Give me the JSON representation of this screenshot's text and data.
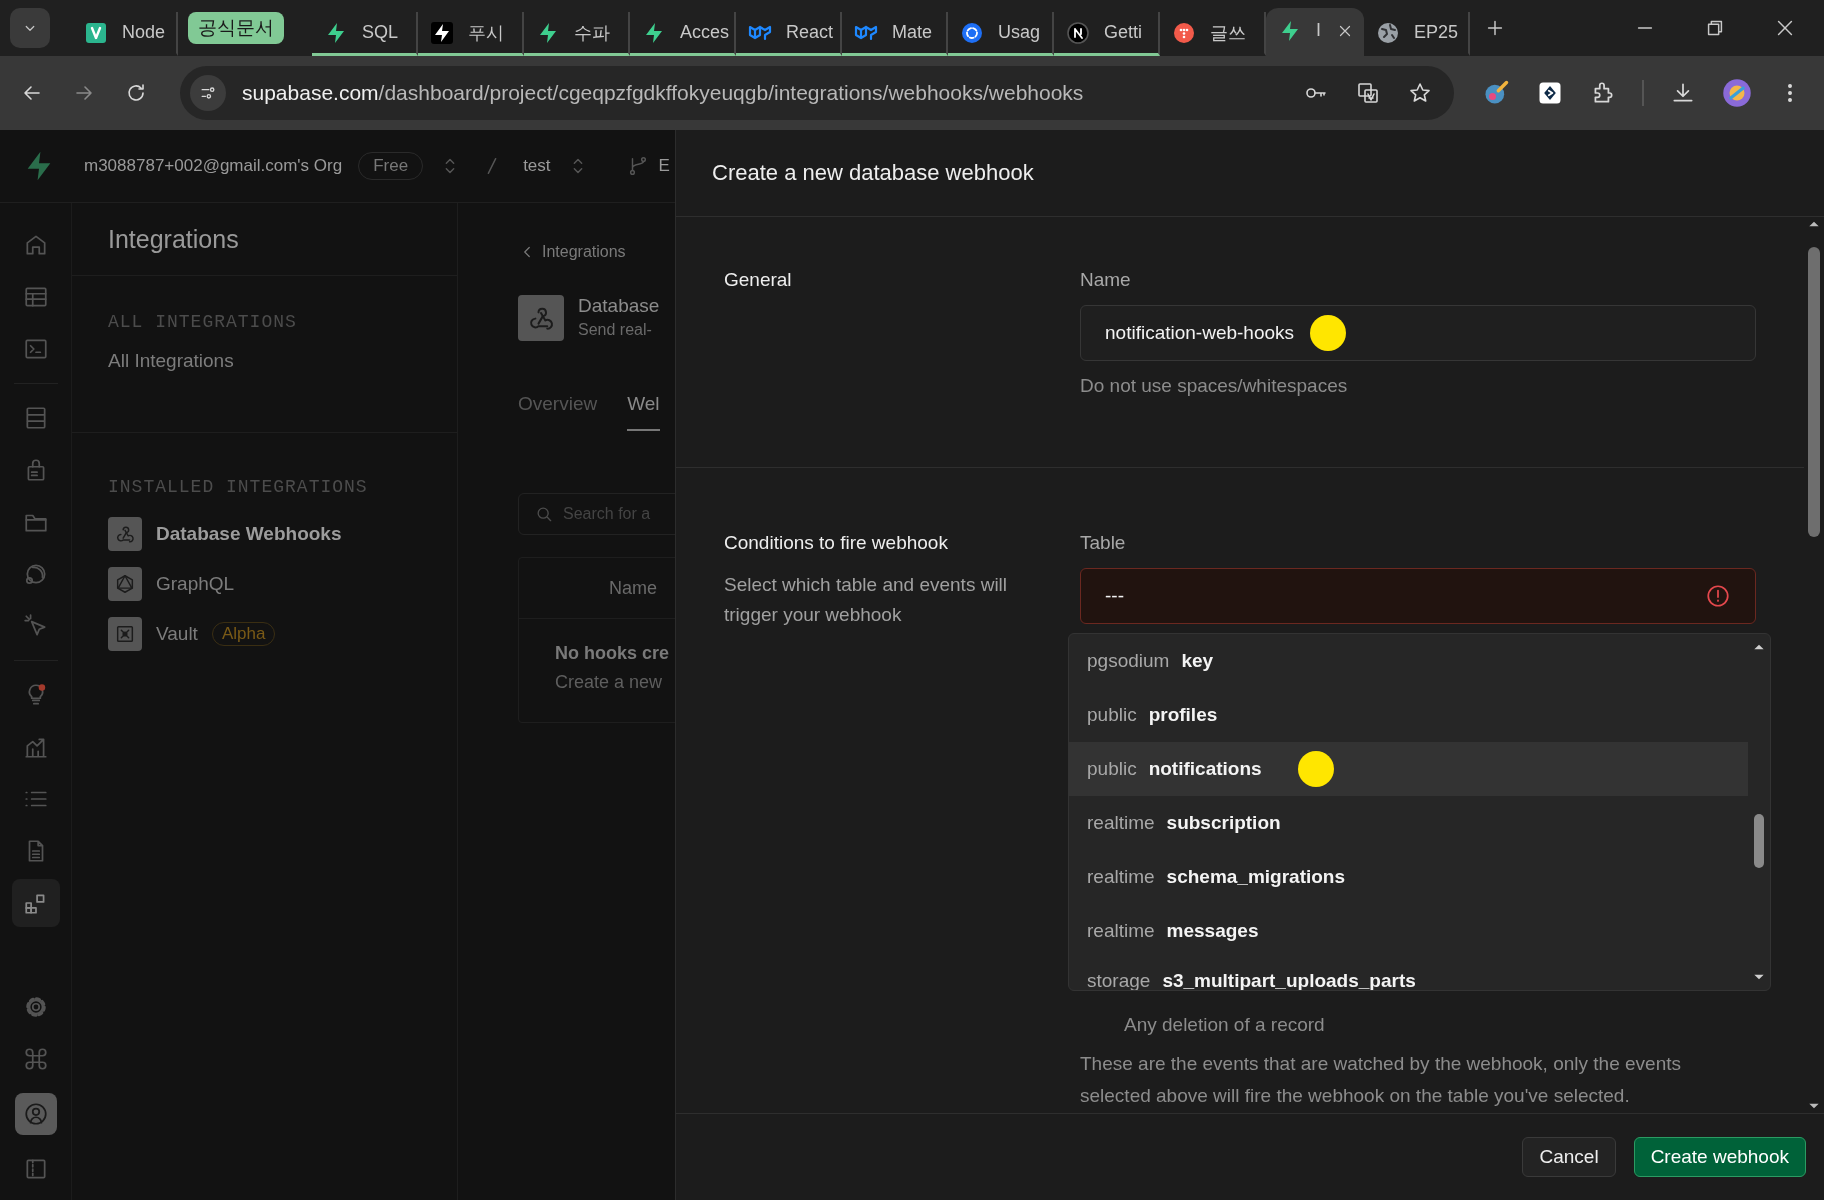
{
  "browser": {
    "tabs": [
      {
        "title": "Node",
        "kind": "square-logo",
        "in_group": false,
        "selected": false
      },
      {
        "title": "SQL",
        "kind": "bolt",
        "in_group": true,
        "selected": false
      },
      {
        "title": "푸시",
        "kind": "bolt-dark",
        "in_group": true,
        "selected": false
      },
      {
        "title": "수파",
        "kind": "bolt",
        "in_group": true,
        "selected": false
      },
      {
        "title": "Acces",
        "kind": "bolt",
        "in_group": true,
        "selected": false
      },
      {
        "title": "React",
        "kind": "mui",
        "in_group": true,
        "selected": false
      },
      {
        "title": "Mate",
        "kind": "mui",
        "in_group": true,
        "selected": false
      },
      {
        "title": "Usag",
        "kind": "swirl",
        "in_group": true,
        "selected": false
      },
      {
        "title": "Getti",
        "kind": "circle-logo",
        "in_group": true,
        "selected": false
      },
      {
        "title": "글쓰",
        "kind": "dots",
        "in_group": false,
        "selected": false
      },
      {
        "title": "I",
        "kind": "bolt",
        "in_group": false,
        "selected": true
      },
      {
        "title": "EP25",
        "kind": "globe",
        "in_group": false,
        "selected": false
      }
    ],
    "tab_group": {
      "label": "공식문서",
      "color": "#81c995"
    },
    "url_host": "supabase.com",
    "url_path": "/dashboard/project/cgeqpzfgdkffokyeuqgb/integrations/webhooks/webhooks"
  },
  "app_header": {
    "org": "m3088787+002@gmail.com's Org",
    "plan": "Free",
    "project": "test",
    "branch": "E"
  },
  "nav_rail": [
    [
      {
        "kind": "home",
        "selected": false
      },
      {
        "kind": "table",
        "selected": false
      },
      {
        "kind": "terminal",
        "selected": false
      }
    ],
    [
      {
        "kind": "database",
        "selected": false
      },
      {
        "kind": "lock",
        "selected": false
      },
      {
        "kind": "folder",
        "selected": false
      },
      {
        "kind": "realtime",
        "selected": false
      },
      {
        "kind": "cursor",
        "selected": false
      }
    ],
    [
      {
        "kind": "bulb",
        "selected": false
      },
      {
        "kind": "chart",
        "selected": false
      },
      {
        "kind": "list",
        "selected": false
      },
      {
        "kind": "document",
        "selected": false
      },
      {
        "kind": "integrations",
        "selected": true
      }
    ],
    [
      {
        "kind": "settings",
        "selected": false
      },
      {
        "kind": "command",
        "selected": false
      },
      {
        "kind": "avatar",
        "selected": false
      },
      {
        "kind": "sidebar",
        "selected": false
      }
    ]
  ],
  "sidebar": {
    "title": "Integrations",
    "sections": [
      {
        "heading": "ALL INTEGRATIONS",
        "items": [
          {
            "label": "All Integrations",
            "kind": "plain",
            "selected": false
          }
        ]
      },
      {
        "heading": "INSTALLED INTEGRATIONS",
        "items": [
          {
            "label": "Database Webhooks",
            "kind": "webhook",
            "selected": true
          },
          {
            "label": "GraphQL",
            "kind": "graphql",
            "selected": false
          },
          {
            "label": "Vault",
            "kind": "vault",
            "selected": false,
            "badge": "Alpha"
          }
        ]
      }
    ]
  },
  "detail": {
    "back_link": "Integrations",
    "title": "Database",
    "subtitle": "Send real-",
    "tabs": [
      {
        "label": "Overview",
        "selected": false
      },
      {
        "label": "Wel",
        "selected": true
      }
    ],
    "search_placeholder": "Search for a",
    "table": {
      "columns": [
        "Name"
      ],
      "empty_title": "No hooks cre",
      "empty_text": "Create a new"
    }
  },
  "modal": {
    "title": "Create a new database webhook",
    "general": {
      "heading": "General",
      "name_label": "Name",
      "name_value": "notification-web-hooks",
      "name_hint": "Do not use spaces/whitespaces"
    },
    "conditions": {
      "heading": "Conditions to fire webhook",
      "description": "Select which table and events will trigger your webhook",
      "table_label": "Table",
      "table_value": "---",
      "table_error": true,
      "options": [
        {
          "schema": "pgsodium",
          "table": "key",
          "highlighted": false
        },
        {
          "schema": "public",
          "table": "profiles",
          "highlighted": false
        },
        {
          "schema": "public",
          "table": "notifications",
          "highlighted": true
        },
        {
          "schema": "realtime",
          "table": "subscription",
          "highlighted": false
        },
        {
          "schema": "realtime",
          "table": "schema_migrations",
          "highlighted": false
        },
        {
          "schema": "realtime",
          "table": "messages",
          "highlighted": false
        },
        {
          "schema": "storage",
          "table": "s3_multipart_uploads_parts",
          "highlighted": false
        }
      ],
      "delete_description": "Any deletion of a record",
      "events_note": "These are the events that are watched by the webhook, only the events selected above will fire the webhook on the table you've selected."
    },
    "buttons": [
      {
        "label": "Cancel",
        "kind": "secondary"
      },
      {
        "label": "Create webhook",
        "kind": "primary"
      }
    ]
  }
}
